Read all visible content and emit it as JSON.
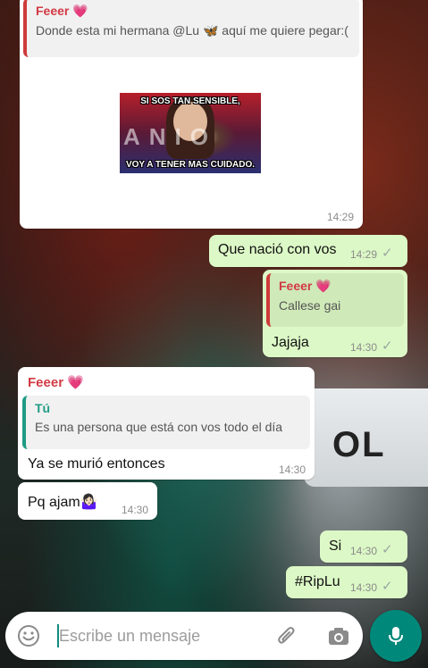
{
  "messages": {
    "m1": {
      "quote_author": "Feeer 💗",
      "quote_text": "Donde esta mi hermana @Lu 🦋 aquí me quiere pegar:(",
      "meme_top": "SI SOS TAN SENSIBLE,",
      "meme_letters": "ANIO",
      "meme_bottom": "VOY A TENER MAS CUIDADO.",
      "time": "14:29"
    },
    "m2": {
      "text": "Que nació con vos",
      "time": "14:29"
    },
    "m3": {
      "quote_author": "Feeer 💗",
      "quote_text": "Callese gai",
      "text": "Jajaja",
      "time": "14:30"
    },
    "m4": {
      "sender": "Feeer 💗",
      "quote_author": "Tú",
      "quote_text": "Es una persona que está con vos todo el día",
      "text": "Ya se murió entonces",
      "time": "14:30"
    },
    "m5": {
      "text": "Pq ajam🤷🏻‍♀️",
      "time": "14:30"
    },
    "m6": {
      "text": "Si",
      "time": "14:30"
    },
    "m7": {
      "text": "#RipLu",
      "time": "14:30"
    }
  },
  "background": {
    "podium_text": "OL"
  },
  "composer": {
    "placeholder": "Escribe un mensaje"
  },
  "icons": {
    "emoji": "emoji-icon",
    "attach": "paperclip-icon",
    "camera": "camera-icon",
    "mic": "microphone-icon",
    "read": "check-icon"
  },
  "colors": {
    "outgoing": "#dcf8c6",
    "incoming": "#ffffff",
    "quote_accent": "#cf3a3a",
    "you_accent": "#1f9b84",
    "mic_button": "#00897b"
  }
}
